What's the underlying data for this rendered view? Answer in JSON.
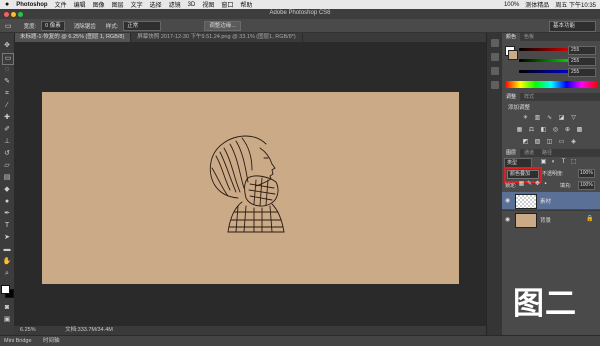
{
  "menubar": {
    "apple": "",
    "app_name": "Photoshop",
    "items": [
      "文件",
      "编辑",
      "图像",
      "图层",
      "文字",
      "选择",
      "滤镜",
      "3D",
      "视图",
      "窗口",
      "帮助"
    ],
    "right_items": [
      "100%",
      "测体精品",
      "周五 下午10:35"
    ]
  },
  "window": {
    "title": "Adobe Photoshop CS6"
  },
  "options": {
    "width_label": "宽度:",
    "width_value": "0 像素",
    "antialias_label": "消除锯齿",
    "style_label": "样式:",
    "style_value": "正常",
    "refine_edge": "调整边缘..."
  },
  "workspace": {
    "label": "基本功能"
  },
  "tabs": [
    {
      "label": "未标题-1-恢复的 @ 6.25% (图层 1, RGB/8)"
    },
    {
      "label": "屏幕快照 2017-12-30 下午9.51.24.png @ 33.1% (图层1, RGB/8*)"
    }
  ],
  "status": {
    "zoom": "6.25%",
    "doc": "文档:333.7M/34.4M"
  },
  "bottom": {
    "items": [
      "Mini Bridge",
      "时间轴"
    ]
  },
  "color_panel": {
    "tabs": [
      "颜色",
      "色板"
    ],
    "values": [
      "255",
      "255",
      "255"
    ]
  },
  "adjust_panel": {
    "tabs": [
      "调整",
      "样式"
    ],
    "heading": "添加调整"
  },
  "layers_panel": {
    "tabs": [
      "图层",
      "通道",
      "路径"
    ],
    "kind": "类型",
    "blend_mode": "颜色叠加",
    "opacity_label": "不透明度:",
    "opacity_value": "100%",
    "lock_label": "锁定:",
    "fill_label": "填充:",
    "fill_value": "100%",
    "layers": [
      {
        "name": "素材"
      },
      {
        "name": "背景"
      }
    ]
  },
  "overlay": {
    "text": "图二"
  },
  "colors": {
    "canvas": "#cbaa88",
    "highlight": "#e02020",
    "selected_layer": "#5a7096"
  }
}
